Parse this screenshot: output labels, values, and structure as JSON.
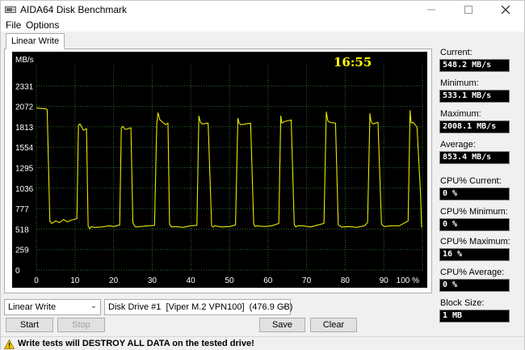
{
  "window": {
    "title": "AIDA64 Disk Benchmark"
  },
  "menu": {
    "file": "File",
    "options": "Options"
  },
  "tabs": [
    {
      "label": "Linear Write"
    }
  ],
  "chart_data": {
    "type": "line",
    "title": "",
    "ylabel": "MB/s",
    "xlabel": "",
    "ylim": [
      0,
      2590
    ],
    "xlim": [
      0,
      100
    ],
    "y_ticks": [
      "2331",
      "2072",
      "1813",
      "1554",
      "1295",
      "1036",
      "777",
      "518",
      "259",
      "0"
    ],
    "x_ticks": [
      "0",
      "10",
      "20",
      "30",
      "40",
      "50",
      "60",
      "70",
      "80",
      "90",
      "100 %"
    ],
    "time_label": "16:55",
    "grid": true,
    "line_color": "#e8e800",
    "series": [
      {
        "x": [
          0,
          2.5,
          2.8,
          3.5,
          4,
          5,
          6,
          7,
          8,
          9,
          10.5,
          10.9,
          11.3,
          12.2,
          13.0,
          13.4,
          13.8,
          14.2,
          15,
          17,
          19,
          20,
          21.6,
          22.0,
          22.4,
          23.0,
          24.5,
          25.0,
          25.4,
          25.7,
          27,
          29,
          30.6,
          31.2,
          31.5,
          32.0,
          33.5,
          34.1,
          34.5,
          35.0,
          36,
          38,
          40,
          41.6,
          42.1,
          42.5,
          43.0,
          44.5,
          45.4,
          45.8,
          46.2,
          48,
          50,
          51.6,
          52.2,
          52.5,
          53.0,
          55.5,
          56.3,
          56.7,
          57.1,
          59,
          61,
          62.8,
          63.3,
          63.6,
          64.2,
          66.0,
          66.8,
          67.2,
          67.6,
          69,
          71,
          73,
          74.5,
          75.1,
          75.5,
          76.0,
          77.5,
          78.2,
          78.6,
          79.0,
          81,
          83,
          85,
          85.8,
          86.4,
          86.7,
          87.2,
          88.5,
          89.4,
          89.8,
          90.2,
          92,
          94,
          96.3,
          96.8,
          97.1,
          97.6,
          98.6,
          99.5,
          99.8
        ],
        "y": [
          2050,
          2040,
          2030,
          620,
          590,
          620,
          600,
          640,
          610,
          630,
          650,
          1830,
          1850,
          1770,
          1790,
          560,
          520,
          550,
          540,
          545,
          560,
          550,
          570,
          1800,
          1820,
          1780,
          1800,
          600,
          560,
          545,
          550,
          560,
          565,
          1850,
          1990,
          1900,
          1840,
          1860,
          580,
          545,
          550,
          540,
          560,
          565,
          1950,
          1870,
          1850,
          1860,
          560,
          545,
          560,
          545,
          550,
          570,
          1920,
          1860,
          1840,
          1860,
          580,
          550,
          560,
          550,
          560,
          590,
          1950,
          1860,
          1880,
          1900,
          575,
          545,
          560,
          560,
          545,
          570,
          590,
          2000,
          1890,
          1870,
          1860,
          570,
          560,
          545,
          550,
          540,
          560,
          600,
          1980,
          1880,
          1850,
          1870,
          580,
          560,
          550,
          560,
          560,
          620,
          2020,
          1860,
          1870,
          1810,
          980,
          540
        ]
      }
    ]
  },
  "stats": [
    {
      "label": "Current:",
      "value": "548.2 MB/s"
    },
    {
      "label": "Minimum:",
      "value": "533.1 MB/s"
    },
    {
      "label": "Maximum:",
      "value": "2008.1 MB/s"
    },
    {
      "label": "Average:",
      "value": "853.4 MB/s"
    },
    {
      "label": "CPU% Current:",
      "value": "0 %"
    },
    {
      "label": "CPU% Minimum:",
      "value": "0 %"
    },
    {
      "label": "CPU% Maximum:",
      "value": "16 %"
    },
    {
      "label": "CPU% Average:",
      "value": "0 %"
    },
    {
      "label": "Block Size:",
      "value": "1 MB"
    }
  ],
  "controls": {
    "test_select": "Linear Write",
    "drive_select": "Disk Drive #1  [Viper M.2 VPN100]  (476.9 GB)",
    "start": "Start",
    "stop": "Stop",
    "save": "Save",
    "clear": "Clear"
  },
  "status": {
    "warning": "Write tests will DESTROY ALL DATA on the tested drive!"
  },
  "icons": {
    "window": "hard-disk-icon",
    "warning": "warning-icon"
  }
}
